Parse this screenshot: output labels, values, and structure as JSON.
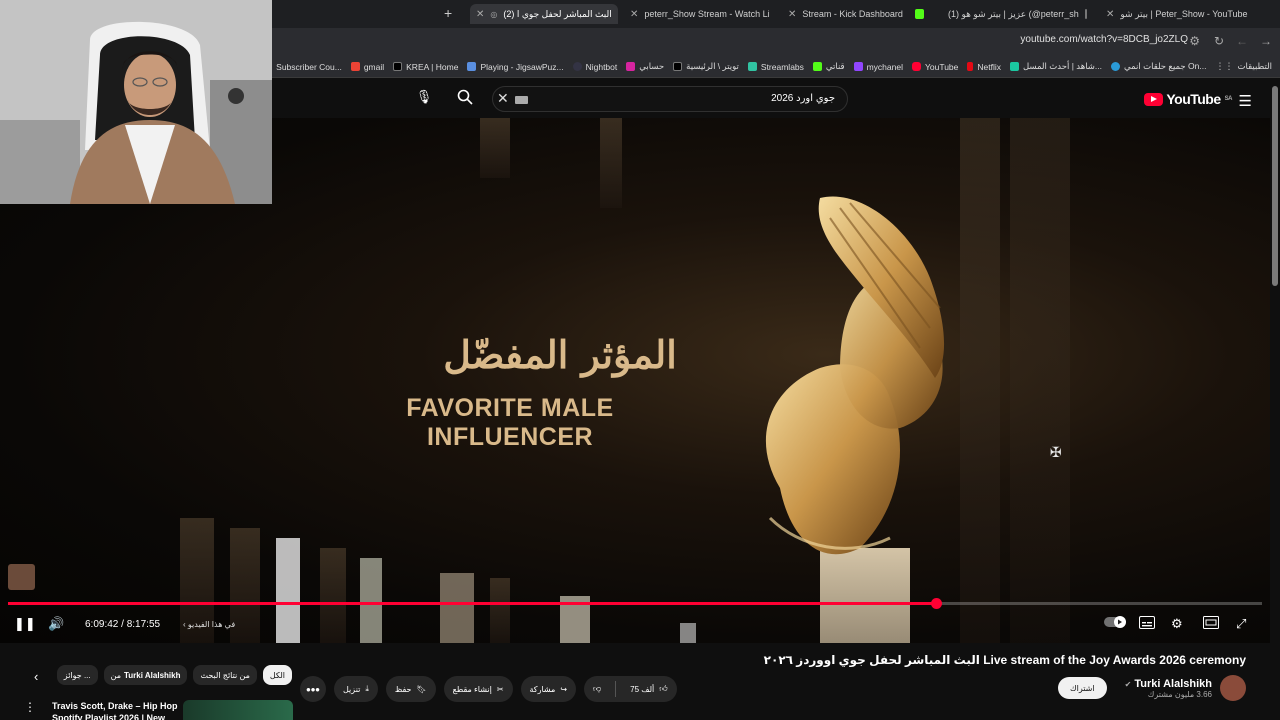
{
  "browser": {
    "tabs": [
      {
        "title": "بيتر شو | Peter_Show - YouTube",
        "icon": "youtube-icon"
      },
      {
        "title": "(1) عزيز | بيتر شو هو (@peterr_sh",
        "icon": "x-icon"
      },
      {
        "title": "Stream - Kick Dashboard",
        "icon": "kick-icon"
      },
      {
        "title": "peterr_Show Stream - Watch Li",
        "icon": "kick-icon"
      },
      {
        "title": "(2) البث المباشر لحفل جوي ا",
        "icon": "youtube-icon",
        "active": true
      }
    ],
    "url": "youtube.com/watch?v=8DCB_jo2ZLQ",
    "bookmarks": [
      "التطبيقات",
      "جميع حلقات انمي On...",
      "شاهد | أحدث المسل...",
      "Netflix",
      "YouTube",
      "mychanel",
      "قناتي",
      "Streamlabs",
      "تويتر \\ الرئيسية",
      "حسابي",
      "Nightbot",
      "Playing - JigsawPuz...",
      "KREA | Home",
      "gmail",
      "Subscriber Cou..."
    ]
  },
  "youtube": {
    "logo_text": "YouTube",
    "logo_region": "SA",
    "search_query": "جوي اورد 2026"
  },
  "video": {
    "overlay_title_ar": "المؤثر المفضّل",
    "overlay_title_en": "FAVORITE MALE INFLUENCER",
    "time_current": "6:09:42",
    "time_total": "8:17:55",
    "time_display": "6:09:42 / 8:17:55",
    "progress_fraction": 0.74,
    "chapter_label": "في هذا الفيديو"
  },
  "page": {
    "video_title": "البث المباشر لحفل جوي اووردز ٢٠٢٦ Live stream of the Joy Awards 2026 ceremony",
    "channel_name": "Turki Alalshikh",
    "channel_subs": "3.66 مليون مشترك",
    "subscribe_label": "اشتراك",
    "likes": "75 ألف",
    "actions": {
      "share": "مشاركة",
      "clip": "إنشاء مقطع",
      "save": "حفظ",
      "download": "تنزيل"
    },
    "chips": [
      {
        "label": "الكل",
        "active": true
      },
      {
        "label": "من نتائج البحث"
      },
      {
        "label": "من",
        "bold": "Turki Alalshikh"
      },
      {
        "label": "جوائز ..."
      }
    ],
    "suggestion_title": "Travis Scott, Drake – Hip Hop Spotify Playlist 2026 | New"
  },
  "colors": {
    "accent": "#ff0033",
    "background": "#0f0f0f",
    "gold": "#d9b98a"
  }
}
